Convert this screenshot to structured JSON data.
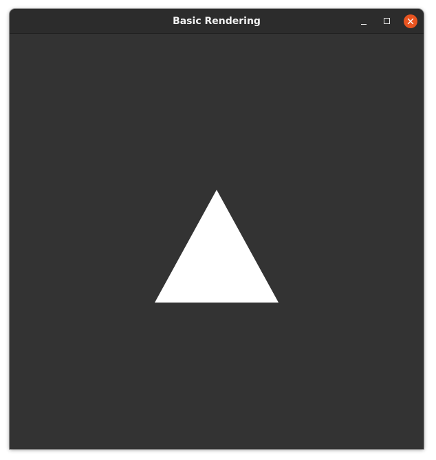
{
  "window": {
    "title": "Basic Rendering"
  },
  "controls": {
    "minimize_icon": "minimize-icon",
    "maximize_icon": "maximize-icon",
    "close_icon": "close-icon"
  },
  "colors": {
    "window_background": "#333333",
    "titlebar_background": "#2c2c2c",
    "title_text": "#f2f2f2",
    "close_button": "#e95420",
    "shape_fill": "#ffffff"
  },
  "scene": {
    "shape": "triangle"
  }
}
